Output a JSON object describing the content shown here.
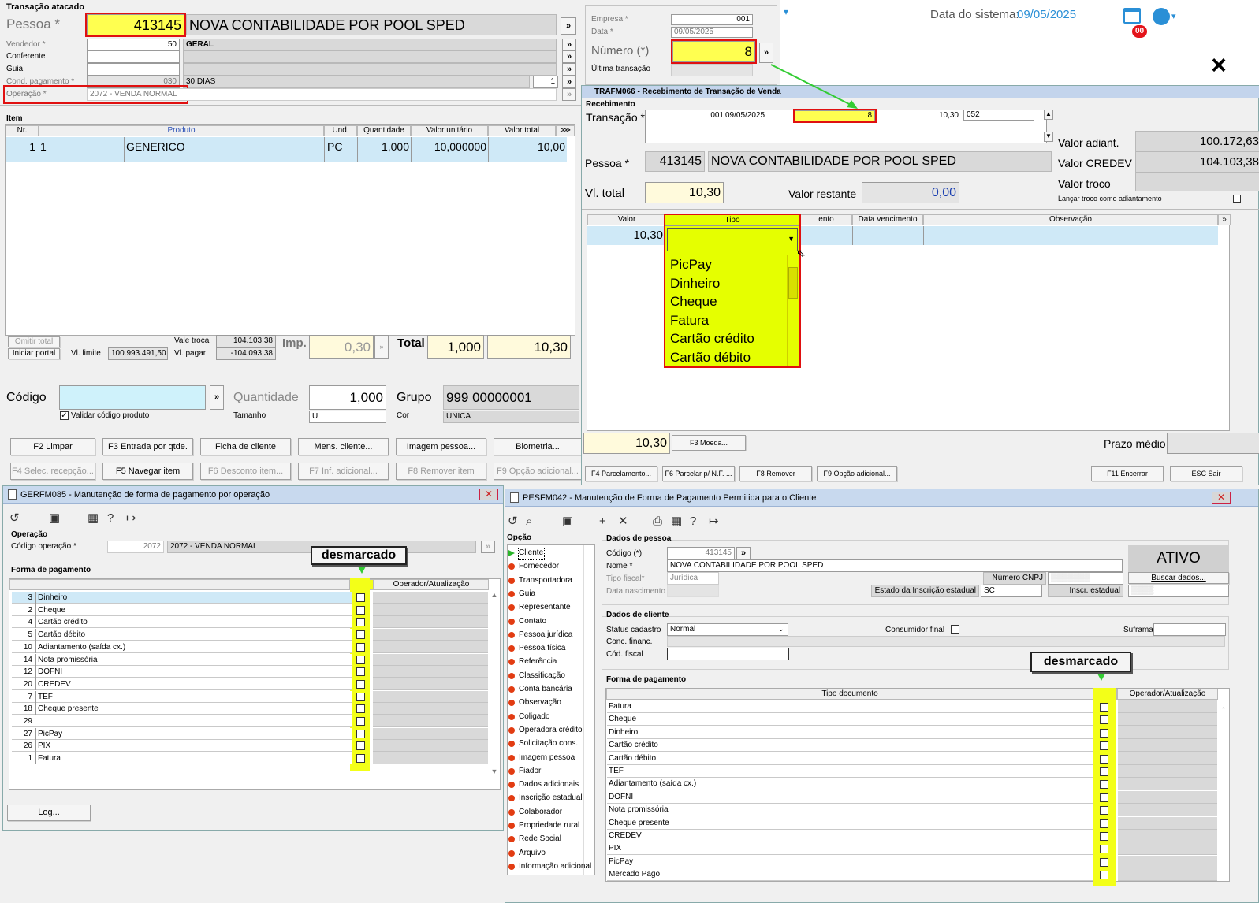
{
  "top": {
    "dropdown_caret": "▾",
    "system_date_label": "Data do sistema:",
    "system_date": "09/05/2025",
    "calendar_badge": "00",
    "close_glyph": "×"
  },
  "ta": {
    "title": "Transação atacado",
    "pessoa_label": "Pessoa *",
    "pessoa_code": "413145",
    "pessoa_name": "NOVA CONTABILIDADE POR POOL SPED",
    "vendedor_label": "Vendedor *",
    "vendedor_code": "50",
    "vendedor_name": "GERAL",
    "conferente_label": "Conferente",
    "guia_label": "Guia",
    "cond_label": "Cond. pagamento *",
    "cond_code": "030",
    "cond_name": "30 DIAS",
    "cond_num": "1",
    "operacao_label": "Operação *",
    "operacao_value": "2072 - VENDA NORMAL",
    "empresa_label": "Empresa *",
    "empresa_value": "001",
    "data_label": "Data *",
    "data_value": "09/05/2025",
    "numero_label": "Número (*)",
    "numero_value": "8",
    "ultima_label": "Última transação",
    "arrow": "»",
    "item_section": "Item",
    "cols": [
      "Nr.",
      "Produto",
      "Und.",
      "Quantidade",
      "Valor unitário",
      "Valor total"
    ],
    "row": {
      "nr": "1",
      "code": "1",
      "produto": "GENERICO",
      "und": "PC",
      "qtd": "1,000",
      "unit": "10,000000",
      "total": "10,00"
    },
    "omitir": "Omitir total",
    "iniciar": "Iniciar portal",
    "vl_limite_label": "Vl. limite",
    "vl_limite": "100.993.491,50",
    "vale_troca_label": "Vale troca",
    "vale_troca": "104.103,38",
    "vl_pagar_label": "Vl. pagar",
    "vl_pagar": "-104.093,38",
    "imp_label": "Imp.",
    "imp_value": "0,30",
    "total_label": "Total",
    "total_qtd": "1,000",
    "total_value": "10,30",
    "codigo_label": "Código",
    "validar_label": "Validar código produto",
    "quantidade_label": "Quantidade",
    "quantidade_value": "1,000",
    "tamanho_label": "Tamanho",
    "tamanho_value": "U",
    "grupo_label": "Grupo",
    "grupo_value": "999 00000001",
    "cor_label": "Cor",
    "cor_value": "UNICA",
    "buttons_row1": [
      "F2 Limpar",
      "F3 Entrada por qtde.",
      "Ficha de cliente",
      "Mens. cliente...",
      "Imagem pessoa...",
      "Biometria..."
    ],
    "buttons_row2": [
      "F4 Selec. recepção...",
      "F5 Navegar item",
      "F6 Desconto item...",
      "F7 Inf. adicional...",
      "F8 Remover item",
      "F9 Opção adicional..."
    ]
  },
  "tr": {
    "title": "TRAFM066 - Recebimento de Transação de Venda",
    "recebimento": "Recebimento",
    "transacao_label": "Transação *",
    "t_empresa": "001",
    "t_data": "09/05/2025",
    "t_numero": "8",
    "t_valor": "10,30",
    "t_seq": "052",
    "pessoa_label": "Pessoa *",
    "pessoa_code": "413145",
    "pessoa_name": "NOVA CONTABILIDADE POR POOL SPED",
    "valor_adiant_label": "Valor adiant.",
    "valor_adiant": "100.172,63",
    "valor_credev_label": "Valor CREDEV",
    "valor_credev": "104.103,38",
    "valor_troco_label": "Valor troco",
    "lancar_label": "Lançar troco como adiantamento",
    "vl_total_label": "Vl. total",
    "vl_total": "10,30",
    "valor_restante_label": "Valor restante",
    "valor_restante": "0,00",
    "cols": {
      "valor": "Valor",
      "tipo": "Tipo",
      "documento": "ento",
      "vencimento": "Data vencimento",
      "observacao": "Observação"
    },
    "row_valor": "10,30",
    "dropdown_options": [
      "PicPay",
      "Dinheiro",
      "Cheque",
      "Fatura",
      "Cartão crédito",
      "Cartão débito"
    ],
    "bottom_total": "10,30",
    "f3_moeda": "F3 Moeda...",
    "prazo_label": "Prazo médio",
    "buttons": [
      "F4 Parcelamento...",
      "F6 Parcelar p/ N.F. ...",
      "F8 Remover",
      "F9 Opção adicional...",
      "F11 Encerrar",
      "ESC Sair"
    ]
  },
  "ger": {
    "title": "GERFM085 - Manutenção de forma de pagamento por operação",
    "operacao_section": "Operação",
    "codigo_label": "Código operação *",
    "codigo_value": "2072",
    "codigo_name": "2072 - VENDA NORMAL",
    "forma_section": "Forma de pagamento",
    "operador_header": "Operador/Atualização",
    "callout": "desmarcado",
    "rows": [
      {
        "n": "3",
        "name": "Dinheiro"
      },
      {
        "n": "2",
        "name": "Cheque"
      },
      {
        "n": "4",
        "name": "Cartão crédito"
      },
      {
        "n": "5",
        "name": "Cartão débito"
      },
      {
        "n": "10",
        "name": "Adiantamento (saída cx.)"
      },
      {
        "n": "14",
        "name": "Nota promissória"
      },
      {
        "n": "12",
        "name": "DOFNI"
      },
      {
        "n": "20",
        "name": "CREDEV"
      },
      {
        "n": "7",
        "name": "TEF"
      },
      {
        "n": "18",
        "name": "Cheque presente"
      },
      {
        "n": "29",
        "name": ""
      },
      {
        "n": "27",
        "name": "PicPay"
      },
      {
        "n": "26",
        "name": "PIX"
      },
      {
        "n": "1",
        "name": "Fatura"
      }
    ],
    "log_button": "Log..."
  },
  "pes": {
    "title": "PESFM042 - Manutenção de Forma de Pagamento Permitida para o Cliente",
    "opcao_label": "Opção",
    "options": [
      "Cliente",
      "Fornecedor",
      "Transportadora",
      "Guia",
      "Representante",
      "Contato",
      "Pessoa jurídica",
      "Pessoa física",
      "Referência",
      "Classificação",
      "Conta bancária",
      "Observação",
      "Coligado",
      "Operadora crédito",
      "Solicitação cons.",
      "Imagem pessoa",
      "Fiador",
      "Dados adicionais",
      "Inscrição estadual",
      "Colaborador",
      "Propriedade rural",
      "Rede Social",
      "Arquivo",
      "Informação adicional"
    ],
    "dados_pessoa": "Dados de pessoa",
    "codigo_label": "Código (*)",
    "codigo_value": "413145",
    "nome_label": "Nome *",
    "nome_value": "NOVA CONTABILIDADE POR POOL SPED",
    "tipo_fiscal_label": "Tipo fiscal*",
    "tipo_fiscal_value": "Jurídica",
    "data_nasc_label": "Data nascimento",
    "cnpj_label": "Número CNPJ",
    "estado_label": "Estado da Inscrição estadual",
    "estado_value": "SC",
    "inscr_label": "Inscr. estadual",
    "ativo": "ATIVO",
    "buscar": "Buscar dados...",
    "dados_cliente": "Dados de cliente",
    "status_label": "Status cadastro",
    "status_value": "Normal",
    "conc_label": "Conc. financ.",
    "cod_fiscal_label": "Cód. fiscal",
    "consumidor_label": "Consumidor final",
    "suframa_label": "Suframa",
    "forma_section": "Forma de pagamento",
    "tipo_doc_header": "Tipo documento",
    "operador_header": "Operador/Atualização",
    "callout": "desmarcado",
    "rows": [
      "Fatura",
      "Cheque",
      "Dinheiro",
      "Cartão crédito",
      "Cartão débito",
      "TEF",
      "Adiantamento (saída cx.)",
      "DOFNI",
      "Nota promissória",
      "Cheque presente",
      "CREDEV",
      "PIX",
      "PicPay",
      "Mercado Pago"
    ]
  },
  "colors": {
    "highlight_red": "#e01010",
    "yellow": "#ffff50",
    "arrow_green": "#33cc33",
    "link_blue": "#2a8fd6"
  }
}
